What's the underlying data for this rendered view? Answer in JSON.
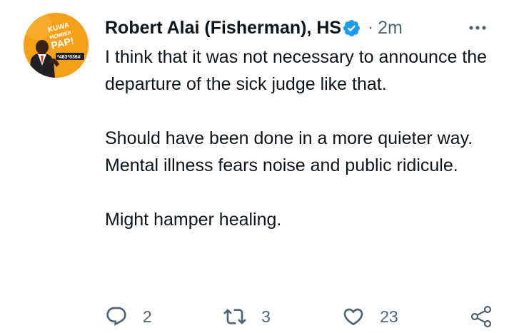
{
  "tweet": {
    "author_name": "Robert Alai (Fisherman), HS",
    "separator": "·",
    "timestamp": "2m",
    "avatar_text": {
      "line1": "KUWA",
      "line2": "MEMBER",
      "line3": "PAP!",
      "code": "*483*036#"
    },
    "paragraphs": [
      "I think that it was not necessary to announce the departure of the sick judge like that.",
      "Should have been done in a more quieter way. Mental illness fears noise and public ridicule.",
      "Might hamper healing."
    ],
    "actions": {
      "reply_count": "2",
      "retweet_count": "3",
      "like_count": "23"
    }
  },
  "colors": {
    "verified": "#1d9bf0",
    "secondary_text": "#536471",
    "avatar_bg": "#f6a11a"
  },
  "icons": [
    "verified-badge-icon",
    "more-icon",
    "reply-icon",
    "retweet-icon",
    "like-icon",
    "share-icon"
  ]
}
